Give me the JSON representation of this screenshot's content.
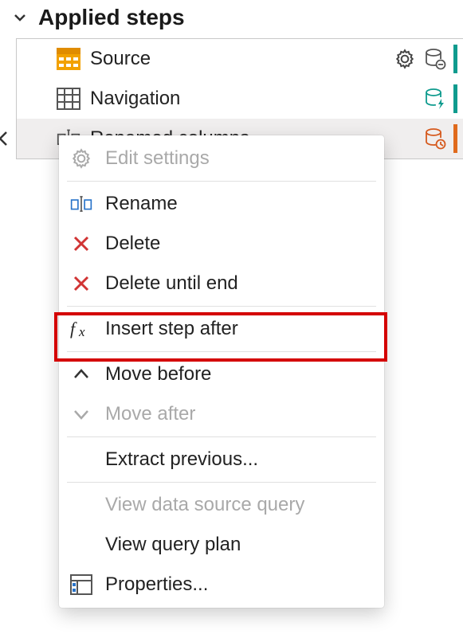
{
  "header": {
    "title": "Applied steps"
  },
  "steps": [
    {
      "label": "Source"
    },
    {
      "label": "Navigation"
    },
    {
      "label": "Renamed columns"
    }
  ],
  "menu": {
    "edit_settings": "Edit settings",
    "rename": "Rename",
    "delete": "Delete",
    "delete_until_end": "Delete until end",
    "insert_step_after": "Insert step after",
    "move_before": "Move before",
    "move_after": "Move after",
    "extract_previous": "Extract previous...",
    "view_data_source_query": "View data source query",
    "view_query_plan": "View query plan",
    "properties": "Properties..."
  }
}
